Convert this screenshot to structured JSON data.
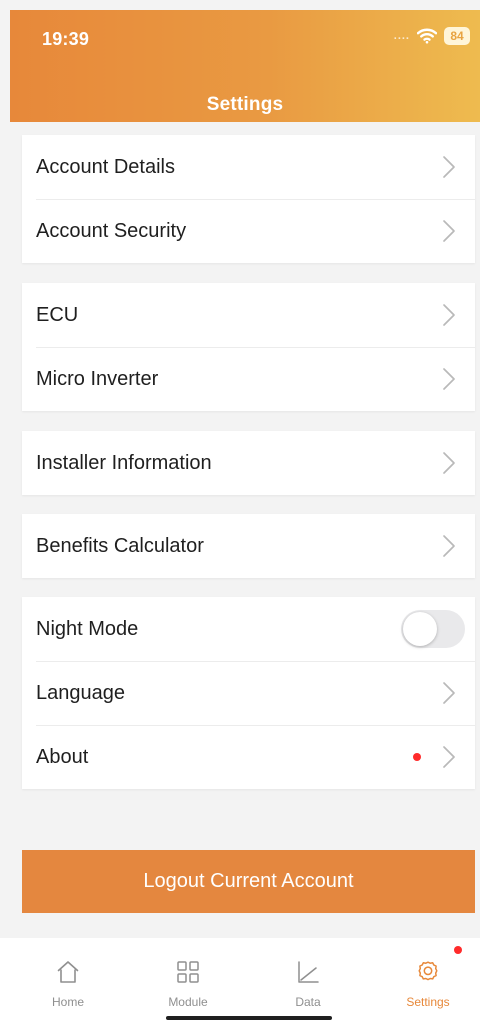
{
  "status_bar": {
    "time": "19:39",
    "signal": "....",
    "battery": "84"
  },
  "header": {
    "title": "Settings"
  },
  "sections": [
    {
      "items": [
        {
          "label": "Account Details"
        },
        {
          "label": "Account Security"
        }
      ]
    },
    {
      "items": [
        {
          "label": "ECU"
        },
        {
          "label": "Micro Inverter"
        }
      ]
    },
    {
      "items": [
        {
          "label": "Installer Information"
        }
      ]
    },
    {
      "items": [
        {
          "label": "Benefits Calculator"
        }
      ]
    },
    {
      "items": [
        {
          "label": "Night Mode"
        },
        {
          "label": "Language"
        },
        {
          "label": "About"
        }
      ]
    }
  ],
  "logout": {
    "label": "Logout Current Account"
  },
  "tabbar": {
    "items": [
      {
        "label": "Home"
      },
      {
        "label": "Module"
      },
      {
        "label": "Data"
      },
      {
        "label": "Settings"
      }
    ]
  },
  "colors": {
    "accent": "#e7883a",
    "badge": "#ff2b2b",
    "toggle_off": "#e9e9eb"
  }
}
